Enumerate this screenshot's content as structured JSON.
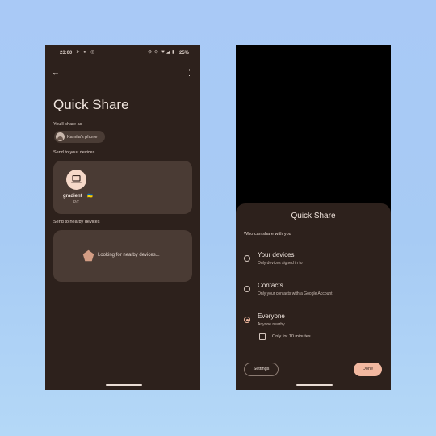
{
  "left_phone": {
    "status_bar": {
      "time": "23:00",
      "icons": [
        "telegram-icon",
        "messenger-icon",
        "camera-icon",
        "mute-icon",
        "dnd-icon",
        "wifi-icon",
        "signal-icon",
        "battery-icon"
      ],
      "battery": "25%"
    },
    "title": "Quick Share",
    "share_as_label": "You'll share as",
    "device_chip": "Kamila's phone",
    "send_to_devices_label": "Send to your devices",
    "device": {
      "name": "gradient",
      "type": "PC",
      "flag": "🇺🇦"
    },
    "send_to_nearby_label": "Send to nearby devices",
    "nearby_status": "Looking for nearby devices..."
  },
  "right_phone": {
    "sheet_title": "Quick Share",
    "who_label": "Who can share with you",
    "options": [
      {
        "title": "Your devices",
        "description": "Only devices signed in to",
        "selected": false
      },
      {
        "title": "Contacts",
        "description": "Only your contacts with a Google Account",
        "selected": false
      },
      {
        "title": "Everyone",
        "description": "Anyone nearby",
        "selected": true
      }
    ],
    "checkbox_label": "Only for 10 minutes",
    "checkbox_checked": false,
    "settings_button": "Settings",
    "done_button": "Done"
  },
  "colors": {
    "background": "#a9c9f6",
    "phone_bg": "#2d211c",
    "card_bg": "#4a3b34",
    "accent": "#f2b8a0"
  }
}
